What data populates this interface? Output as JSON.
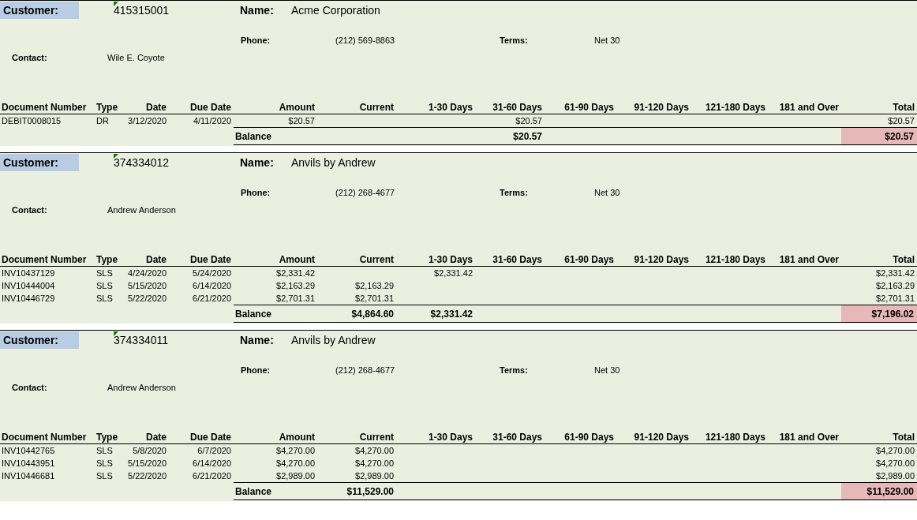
{
  "customers": [
    {
      "customer_label": "Customer:",
      "customer_id": "415315001",
      "name_label": "Name:",
      "name": "Acme Corporation",
      "phone_label": "Phone:",
      "phone": "(212) 569-8863",
      "terms_label": "Terms:",
      "terms": "Net 30",
      "contact_label": "Contact:",
      "contact": "Wile E. Coyote",
      "columns": [
        "Document Number",
        "Type",
        "Date",
        "Due Date",
        "Amount",
        "Current",
        "1-30 Days",
        "31-60 Days",
        "61-90 Days",
        "91-120 Days",
        "121-180 Days",
        "181 and Over",
        "Total"
      ],
      "rows": [
        {
          "cells": [
            "DEBIT0008015",
            "DR",
            "3/12/2020",
            "4/11/2020",
            "$20.57",
            null,
            null,
            "$20.57",
            null,
            null,
            null,
            null,
            "$20.57"
          ]
        }
      ],
      "balance": {
        "label": "Balance",
        "cells": [
          null,
          null,
          "$20.57",
          null,
          null,
          null,
          null,
          "$20.57"
        ]
      }
    },
    {
      "customer_label": "Customer:",
      "customer_id": "374334012",
      "name_label": "Name:",
      "name": "Anvils by Andrew",
      "phone_label": "Phone:",
      "phone": "(212) 268-4677",
      "terms_label": "Terms:",
      "terms": "Net 30",
      "contact_label": "Contact:",
      "contact": "Andrew Anderson",
      "columns": [
        "Document Number",
        "Type",
        "Date",
        "Due Date",
        "Amount",
        "Current",
        "1-30 Days",
        "31-60 Days",
        "61-90 Days",
        "91-120 Days",
        "121-180 Days",
        "181 and Over",
        "Total"
      ],
      "rows": [
        {
          "cells": [
            "INV10437129",
            "SLS",
            "4/24/2020",
            "5/24/2020",
            "$2,331.42",
            null,
            "$2,331.42",
            null,
            null,
            null,
            null,
            null,
            "$2,331.42"
          ]
        },
        {
          "cells": [
            "INV10444004",
            "SLS",
            "5/15/2020",
            "6/14/2020",
            "$2,163.29",
            "$2,163.29",
            null,
            null,
            null,
            null,
            null,
            null,
            "$2,163.29"
          ]
        },
        {
          "cells": [
            "INV10446729",
            "SLS",
            "5/22/2020",
            "6/21/2020",
            "$2,701.31",
            "$2,701.31",
            null,
            null,
            null,
            null,
            null,
            null,
            "$2,701.31"
          ]
        }
      ],
      "balance": {
        "label": "Balance",
        "cells": [
          "$4,864.60",
          "$2,331.42",
          null,
          null,
          null,
          null,
          null,
          "$7,196.02"
        ]
      }
    },
    {
      "customer_label": "Customer:",
      "customer_id": "374334011",
      "name_label": "Name:",
      "name": "Anvils by Andrew",
      "phone_label": "Phone:",
      "phone": "(212) 268-4677",
      "terms_label": "Terms:",
      "terms": "Net 30",
      "contact_label": "Contact:",
      "contact": "Andrew Anderson",
      "columns": [
        "Document Number",
        "Type",
        "Date",
        "Due Date",
        "Amount",
        "Current",
        "1-30 Days",
        "31-60 Days",
        "61-90 Days",
        "91-120 Days",
        "121-180 Days",
        "181 and Over",
        "Total"
      ],
      "rows": [
        {
          "cells": [
            "INV10442765",
            "SLS",
            "5/8/2020",
            "6/7/2020",
            "$4,270.00",
            "$4,270.00",
            null,
            null,
            null,
            null,
            null,
            null,
            "$4,270.00"
          ]
        },
        {
          "cells": [
            "INV10443951",
            "SLS",
            "5/15/2020",
            "6/14/2020",
            "$4,270.00",
            "$4,270.00",
            null,
            null,
            null,
            null,
            null,
            null,
            "$4,270.00"
          ]
        },
        {
          "cells": [
            "INV10446681",
            "SLS",
            "5/22/2020",
            "6/21/2020",
            "$2,989.00",
            "$2,989.00",
            null,
            null,
            null,
            null,
            null,
            null,
            "$2,989.00"
          ]
        }
      ],
      "balance": {
        "label": "Balance",
        "cells": [
          "$11,529.00",
          null,
          null,
          null,
          null,
          null,
          null,
          "$11,529.00"
        ]
      }
    }
  ]
}
